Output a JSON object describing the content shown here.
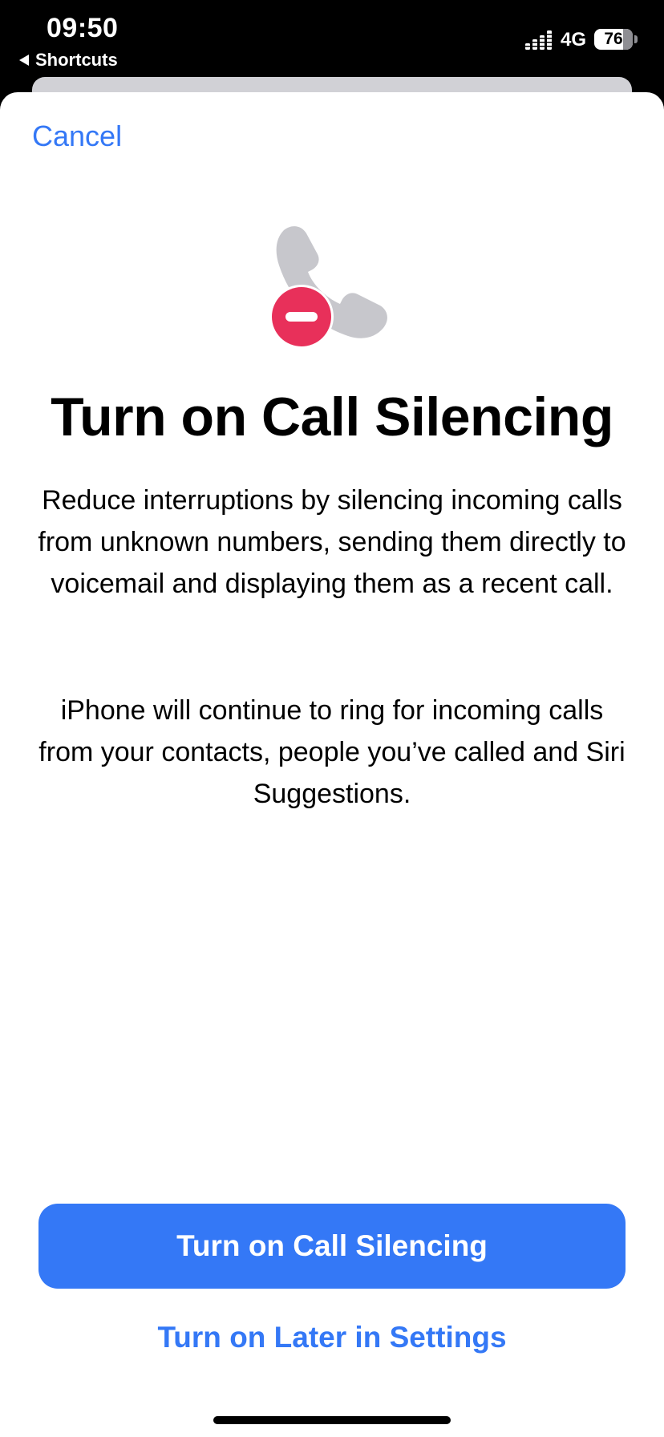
{
  "status_bar": {
    "time": "09:50",
    "back_app": "Shortcuts",
    "network": "4G",
    "battery": "76"
  },
  "sheet": {
    "cancel_label": "Cancel",
    "icon": "phone-silence-icon",
    "title": "Turn on Call Silencing",
    "description_1": "Reduce interruptions by silencing incoming calls from unknown numbers, sending them directly to voicemail and displaying them as a recent call.",
    "description_2": "iPhone will continue to ring for incoming calls from your contacts, people you’ve called and Siri Suggestions.",
    "primary_button": "Turn on Call Silencing",
    "secondary_button": "Turn on Later in Settings"
  },
  "colors": {
    "accent": "#3478f6",
    "badge_red": "#e8305a",
    "icon_gray": "#c7c7cc"
  }
}
